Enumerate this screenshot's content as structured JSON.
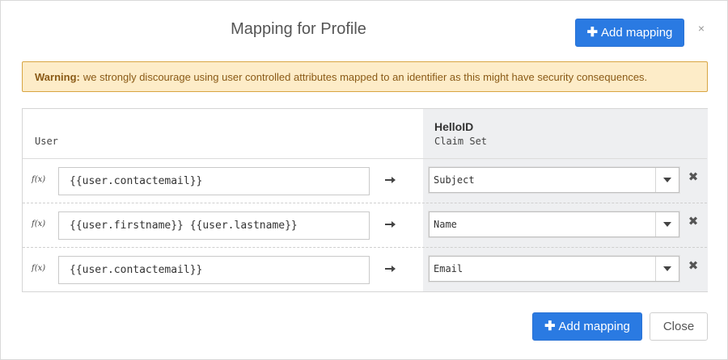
{
  "modal": {
    "title": "Mapping for Profile",
    "add_mapping_label": "Add mapping",
    "close_x": "×",
    "close_label": "Close"
  },
  "warning": {
    "bold": "Warning:",
    "text": "we strongly discourage using user controlled attributes mapped to an identifier as this might have security consequences."
  },
  "table": {
    "left_header": "User",
    "right_header_title": "HelloID",
    "right_header_sub": "Claim Set",
    "fx_label": "f(x)",
    "rows": [
      {
        "expression": "{{user.contactemail}}",
        "claim": "Subject"
      },
      {
        "expression": "{{user.firstname}} {{user.lastname}}",
        "claim": "Name"
      },
      {
        "expression": "{{user.contactemail}}",
        "claim": "Email"
      }
    ]
  },
  "icons": {
    "plus": "plus-icon",
    "arrow": "arrow-right-icon",
    "delete": "delete-icon",
    "caret": "chevron-down-icon",
    "close": "close-icon"
  },
  "colors": {
    "primary": "#2a7ae2",
    "warning_bg": "#fdecc8",
    "warning_border": "#d8a542",
    "warning_text": "#8a5a16",
    "claim_panel_bg": "#eeeff1"
  }
}
